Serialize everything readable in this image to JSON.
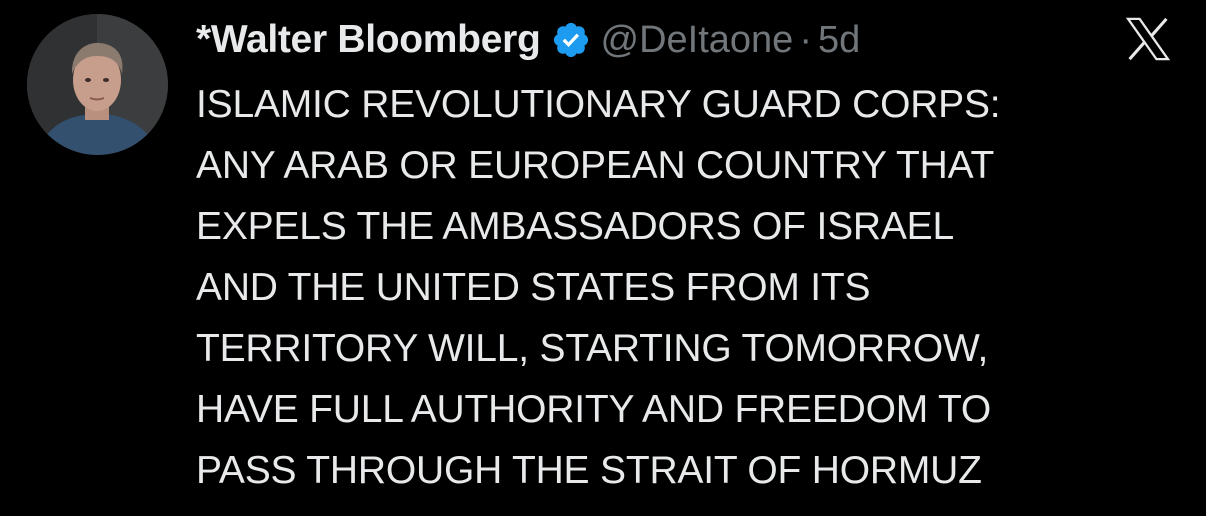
{
  "tweet": {
    "display_name": "*Walter Bloomberg",
    "handle": "@DeItaone",
    "separator": "·",
    "time": "5d",
    "text": "ISLAMIC REVOLUTIONARY GUARD CORPS:\nANY ARAB OR EUROPEAN COUNTRY THAT\nEXPELS THE AMBASSADORS OF ISRAEL\nAND THE UNITED STATES FROM ITS\nTERRITORY WILL, STARTING TOMORROW,\nHAVE FULL AUTHORITY AND FREEDOM TO\nPASS THROUGH THE STRAIT OF HORMUZ",
    "verified": true
  },
  "icons": {
    "verified": "verified-badge-icon",
    "platform": "x-logo-icon"
  },
  "colors": {
    "background": "#000000",
    "primary_text": "#e7e9ea",
    "secondary_text": "#71767b",
    "verified_blue": "#1d9bf0"
  }
}
